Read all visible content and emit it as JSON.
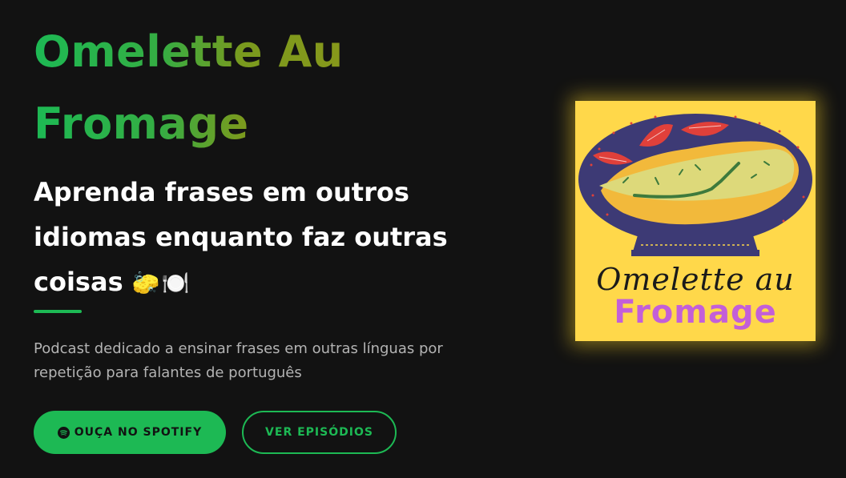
{
  "hero": {
    "title_line1": "Omelette Au",
    "title_line2": "Fromage",
    "subtitle_line1": "Aprenda frases em outros",
    "subtitle_line2": "idiomas enquanto faz outras",
    "subtitle_line3": "coisas",
    "subtitle_emoji": "🧽🍽️",
    "description_line1": "Podcast dedicado a ensinar frases em outras línguas por",
    "description_line2": "repetição para falantes de português"
  },
  "actions": {
    "spotify_label": "OUÇA NO SPOTIFY",
    "spotify_icon": "spotify-icon",
    "episodes_label": "VER EPISÓDIOS"
  },
  "cover": {
    "title_line1": "Omelette au",
    "title_line2": "Fromage"
  },
  "colors": {
    "background": "#121212",
    "accent": "#1db954",
    "title_gradient_end": "#8a971a",
    "cover_background": "#ffd84a",
    "cover_bowl": "#3d3a75",
    "cover_title_purple": "#c35fd8"
  }
}
